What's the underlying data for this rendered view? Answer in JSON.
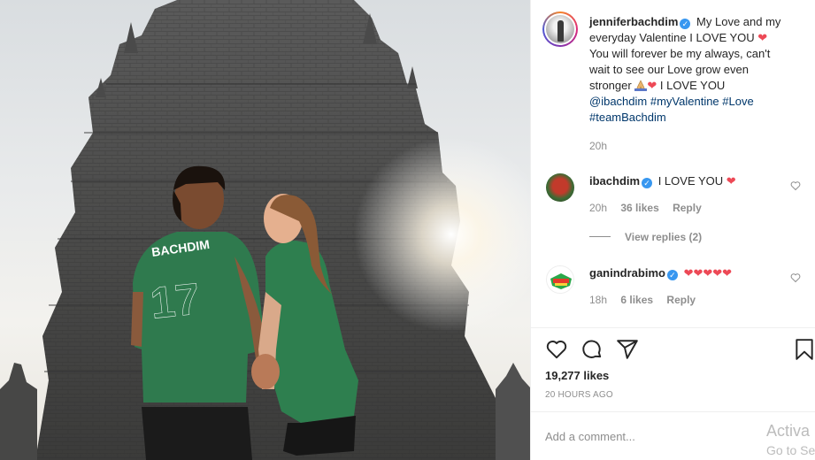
{
  "post": {
    "author": "jenniferbachdim",
    "caption_line1": "My Love and my",
    "caption_line2": "everyday Valentine I LOVE YOU",
    "caption_line3": "You will forever be my always, can't",
    "caption_line4": "wait to see our Love grow even",
    "caption_line5": "stronger",
    "caption_line5b": "I LOVE YOU",
    "mention": "@ibachdim",
    "hashtag1": "#myValentine",
    "hashtag2": "#Love",
    "hashtag3": "#teamBachdim",
    "caption_time": "20h"
  },
  "comments": [
    {
      "user": "ibachdim",
      "text": "I LOVE YOU",
      "time": "20h",
      "likes": "36 likes",
      "reply": "Reply"
    },
    {
      "user": "ganindrabimo",
      "text": "",
      "time": "18h",
      "likes": "6 likes",
      "reply": "Reply"
    }
  ],
  "view_replies": "View replies (2)",
  "likes_count": "19,277 likes",
  "timestamp": "20 HOURS AGO",
  "comment_placeholder": "Add a comment...",
  "watermark": {
    "line1": "Activa",
    "line2": "Go to Se"
  },
  "photo": {
    "jersey_name": "BACHDIM",
    "jersey_number": "17"
  },
  "icons": [
    "verified-badge-icon",
    "heart-icon",
    "comment-icon",
    "share-icon",
    "bookmark-icon",
    "prayer-hands-emoji"
  ],
  "colors": {
    "link": "#00376b",
    "heart": "#ed4956",
    "verified": "#3897f0",
    "muted": "#8e8e8e"
  }
}
